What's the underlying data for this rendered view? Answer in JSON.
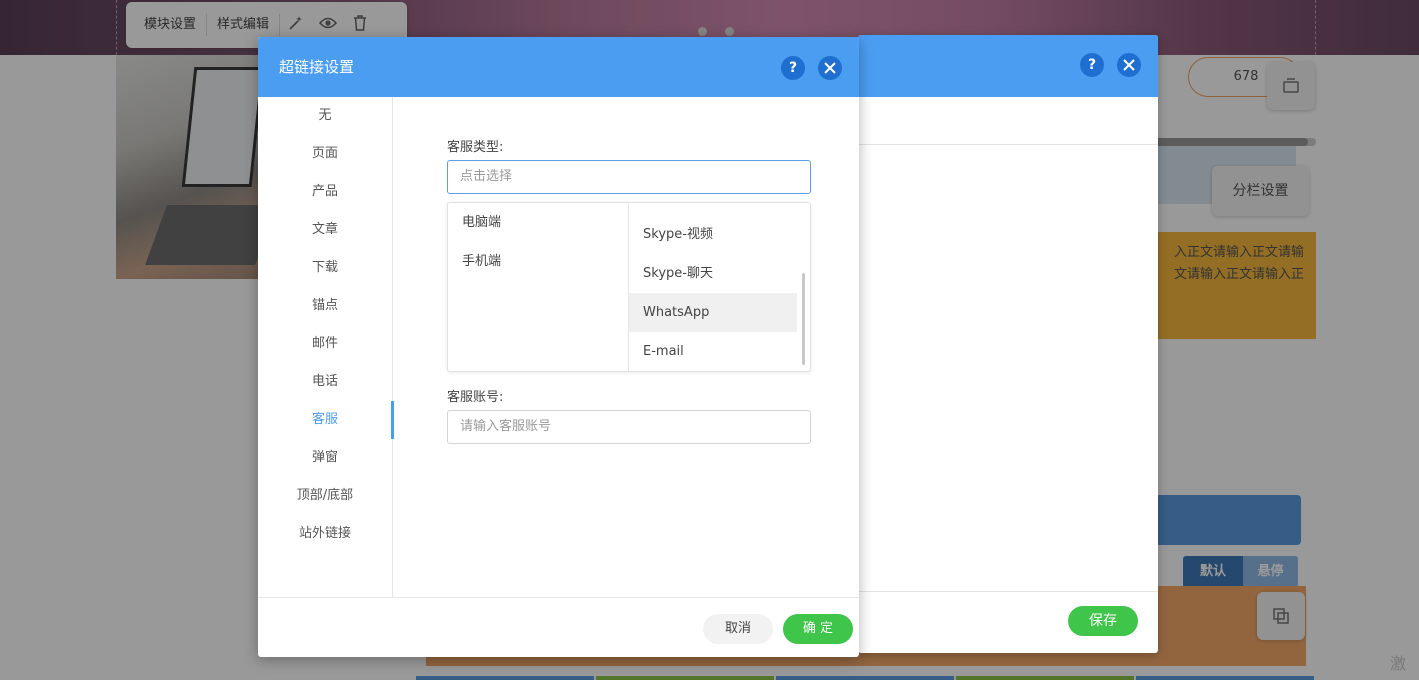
{
  "background": {
    "toolbar": {
      "module_settings": "模块设置",
      "style_edit": "样式编辑",
      "icons": [
        "magic-wand-icon",
        "eye-icon",
        "trash-icon"
      ]
    },
    "counter": "678",
    "column_settings": "分栏设置",
    "body_text_lines": [
      "入正文请输入正文请输",
      "文请输入正文请输入正"
    ],
    "tabs": {
      "default": "默认",
      "hover": "悬停"
    },
    "watermark": "激"
  },
  "back_dialog": {
    "save": "保存"
  },
  "dialog": {
    "title": "超链接设置",
    "sidebar": [
      "无",
      "页面",
      "产品",
      "文章",
      "下载",
      "锚点",
      "邮件",
      "电话",
      "客服",
      "弹窗",
      "顶部/底部",
      "站外链接"
    ],
    "active_item": "客服",
    "service_type_label": "客服类型:",
    "service_type_placeholder": "点击选择",
    "platforms": [
      "电脑端",
      "手机端"
    ],
    "service_options": [
      "Skype-视频",
      "Skype-聊天",
      "WhatsApp",
      "E-mail"
    ],
    "highlighted_option": "WhatsApp",
    "account_label": "客服账号:",
    "account_placeholder": "请输入客服账号",
    "cancel": "取消",
    "confirm": "确 定"
  },
  "colors": {
    "header_blue": "#4b9df2",
    "confirm_green": "#3fc54a",
    "icon_blue": "#1e6fd0"
  }
}
